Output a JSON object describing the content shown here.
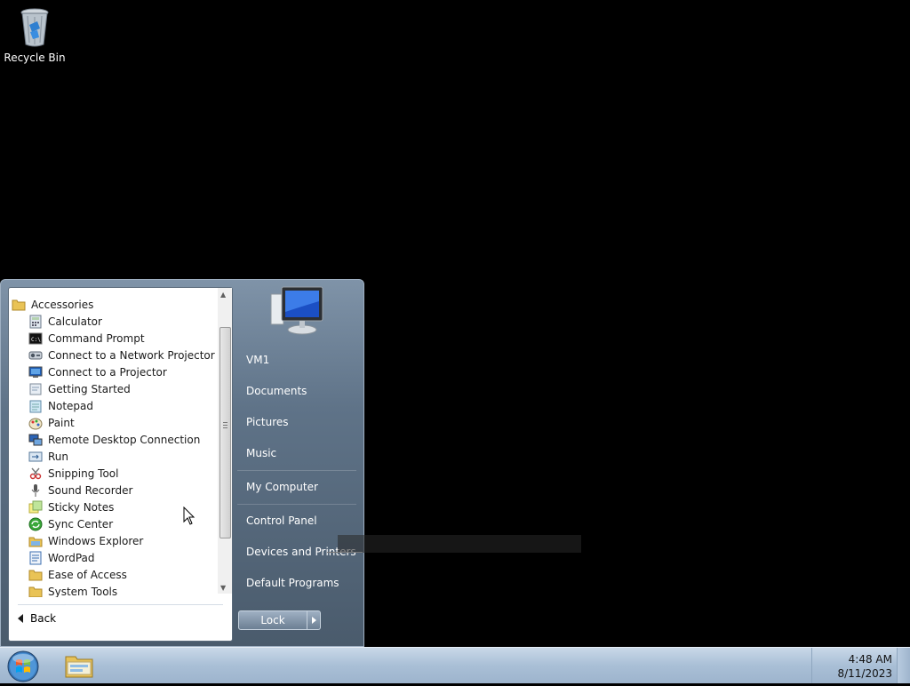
{
  "desktop": {
    "icons": [
      {
        "label": "Recycle Bin",
        "icon": "recycle-bin-icon"
      }
    ]
  },
  "start_menu": {
    "programs": [
      {
        "label": "Accessories",
        "icon": "folder-icon"
      },
      {
        "label": "Calculator",
        "icon": "calculator-icon"
      },
      {
        "label": "Command Prompt",
        "icon": "command-prompt-icon"
      },
      {
        "label": "Connect to a Network Projector",
        "icon": "network-projector-icon"
      },
      {
        "label": "Connect to a Projector",
        "icon": "projector-icon"
      },
      {
        "label": "Getting Started",
        "icon": "getting-started-icon"
      },
      {
        "label": "Notepad",
        "icon": "notepad-icon"
      },
      {
        "label": "Paint",
        "icon": "paint-icon"
      },
      {
        "label": "Remote Desktop Connection",
        "icon": "remote-desktop-icon"
      },
      {
        "label": "Run",
        "icon": "run-icon"
      },
      {
        "label": "Snipping Tool",
        "icon": "snipping-tool-icon"
      },
      {
        "label": "Sound Recorder",
        "icon": "microphone-icon"
      },
      {
        "label": "Sticky Notes",
        "icon": "sticky-notes-icon"
      },
      {
        "label": "Sync Center",
        "icon": "sync-center-icon"
      },
      {
        "label": "Windows Explorer",
        "icon": "windows-explorer-icon"
      },
      {
        "label": "WordPad",
        "icon": "wordpad-icon"
      },
      {
        "label": "Ease of Access",
        "icon": "folder-icon"
      },
      {
        "label": "System Tools",
        "icon": "folder-icon"
      }
    ],
    "back_label": "Back",
    "right_items": [
      {
        "label": "VM1"
      },
      {
        "label": "Documents"
      },
      {
        "label": "Pictures"
      },
      {
        "label": "Music"
      },
      {
        "label": "My Computer"
      },
      {
        "label": "Control Panel"
      },
      {
        "label": "Devices and Printers"
      },
      {
        "label": "Default Programs"
      }
    ],
    "lock_label": "Lock"
  },
  "taskbar": {
    "time": "4:48 AM",
    "date": "8/11/2023"
  }
}
